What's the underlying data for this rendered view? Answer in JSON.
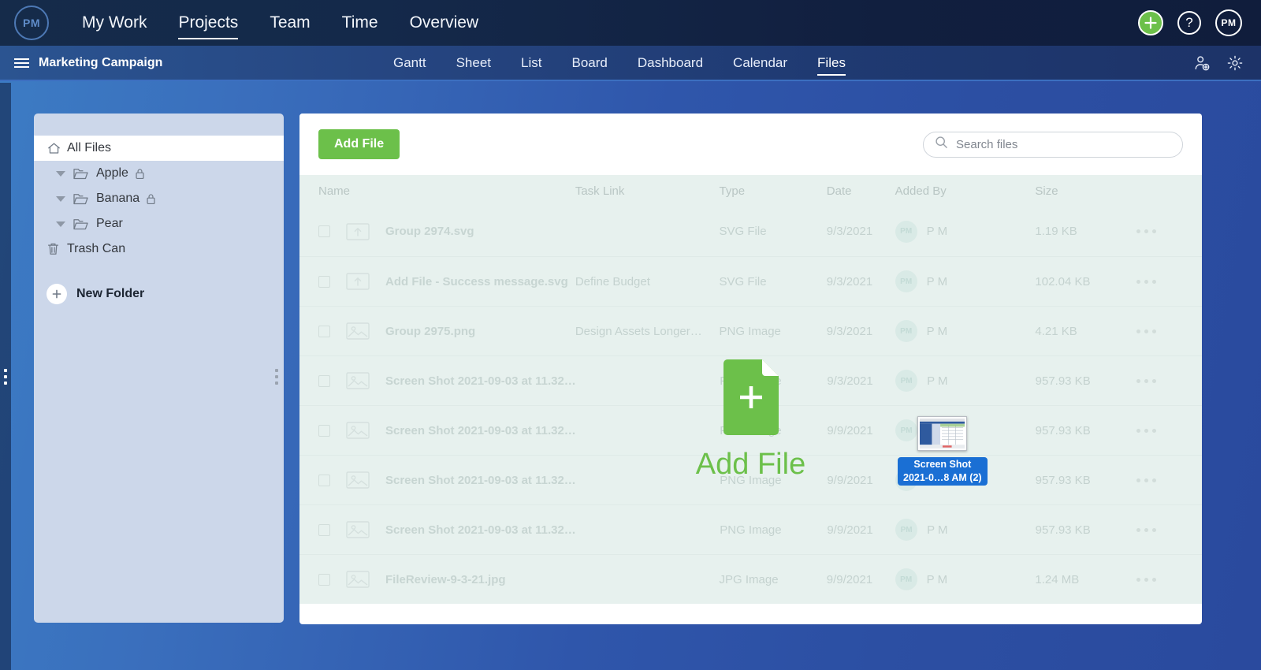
{
  "topbar": {
    "logo_text": "PM",
    "nav": [
      {
        "label": "My Work",
        "active": false
      },
      {
        "label": "Projects",
        "active": true
      },
      {
        "label": "Team",
        "active": false
      },
      {
        "label": "Time",
        "active": false
      },
      {
        "label": "Overview",
        "active": false
      }
    ],
    "help_glyph": "?",
    "avatar_text": "PM"
  },
  "projectbar": {
    "title": "Marketing Campaign",
    "tabs": [
      {
        "label": "Gantt",
        "active": false
      },
      {
        "label": "Sheet",
        "active": false
      },
      {
        "label": "List",
        "active": false
      },
      {
        "label": "Board",
        "active": false
      },
      {
        "label": "Dashboard",
        "active": false
      },
      {
        "label": "Calendar",
        "active": false
      },
      {
        "label": "Files",
        "active": true
      }
    ]
  },
  "sidebar": {
    "all_files": "All Files",
    "folders": [
      {
        "label": "Apple",
        "locked": true
      },
      {
        "label": "Banana",
        "locked": true
      },
      {
        "label": "Pear",
        "locked": false
      }
    ],
    "trash": "Trash Can",
    "new_folder": "New Folder"
  },
  "toolbar": {
    "add_file_label": "Add File",
    "search_placeholder": "Search files",
    "search_value": ""
  },
  "table": {
    "columns": [
      "Name",
      "Task Link",
      "Type",
      "Date",
      "Added By",
      "Size"
    ],
    "rows": [
      {
        "name": "Group 2974.svg",
        "link": "",
        "type": "SVG File",
        "date": "9/3/2021",
        "added_by": "P M",
        "avatar": "PM",
        "size": "1.19 KB"
      },
      {
        "name": "Add File - Success message.svg",
        "link": "Define Budget",
        "type": "SVG File",
        "date": "9/3/2021",
        "added_by": "P M",
        "avatar": "PM",
        "size": "102.04 KB"
      },
      {
        "name": "Group 2975.png",
        "link": "Design Assets Longer…",
        "type": "PNG Image",
        "date": "9/3/2021",
        "added_by": "P M",
        "avatar": "PM",
        "size": "4.21 KB"
      },
      {
        "name": "Screen Shot 2021-09-03 at 11.32…",
        "link": "",
        "type": "PNG Image",
        "date": "9/3/2021",
        "added_by": "P M",
        "avatar": "PM",
        "size": "957.93 KB"
      },
      {
        "name": "Screen Shot 2021-09-03 at 11.32…",
        "link": "",
        "type": "PNG Image",
        "date": "9/9/2021",
        "added_by": "P M",
        "avatar": "PM",
        "size": "957.93 KB"
      },
      {
        "name": "Screen Shot 2021-09-03 at 11.32…",
        "link": "",
        "type": "PNG Image",
        "date": "9/9/2021",
        "added_by": "P M",
        "avatar": "PM",
        "size": "957.93 KB"
      },
      {
        "name": "Screen Shot 2021-09-03 at 11.32…",
        "link": "",
        "type": "PNG Image",
        "date": "9/9/2021",
        "added_by": "P M",
        "avatar": "PM",
        "size": "957.93 KB"
      },
      {
        "name": "FileReview-9-3-21.jpg",
        "link": "",
        "type": "JPG Image",
        "date": "9/9/2021",
        "added_by": "P M",
        "avatar": "PM",
        "size": "1.24 MB"
      }
    ]
  },
  "dropzone": {
    "label": "Add File"
  },
  "drag_ghost": {
    "line1": "Screen Shot",
    "line2": "2021-0…8 AM (2)"
  },
  "colors": {
    "accent_green": "#6cc04a",
    "nav_dark": "#111f3f",
    "project_blue": "#25447f",
    "page_blue": "#2f56ab",
    "sidebar_bg": "#ccd7ea",
    "dropzone_tint": "#e7f1ee",
    "drag_label_blue": "#1a6fd4"
  }
}
